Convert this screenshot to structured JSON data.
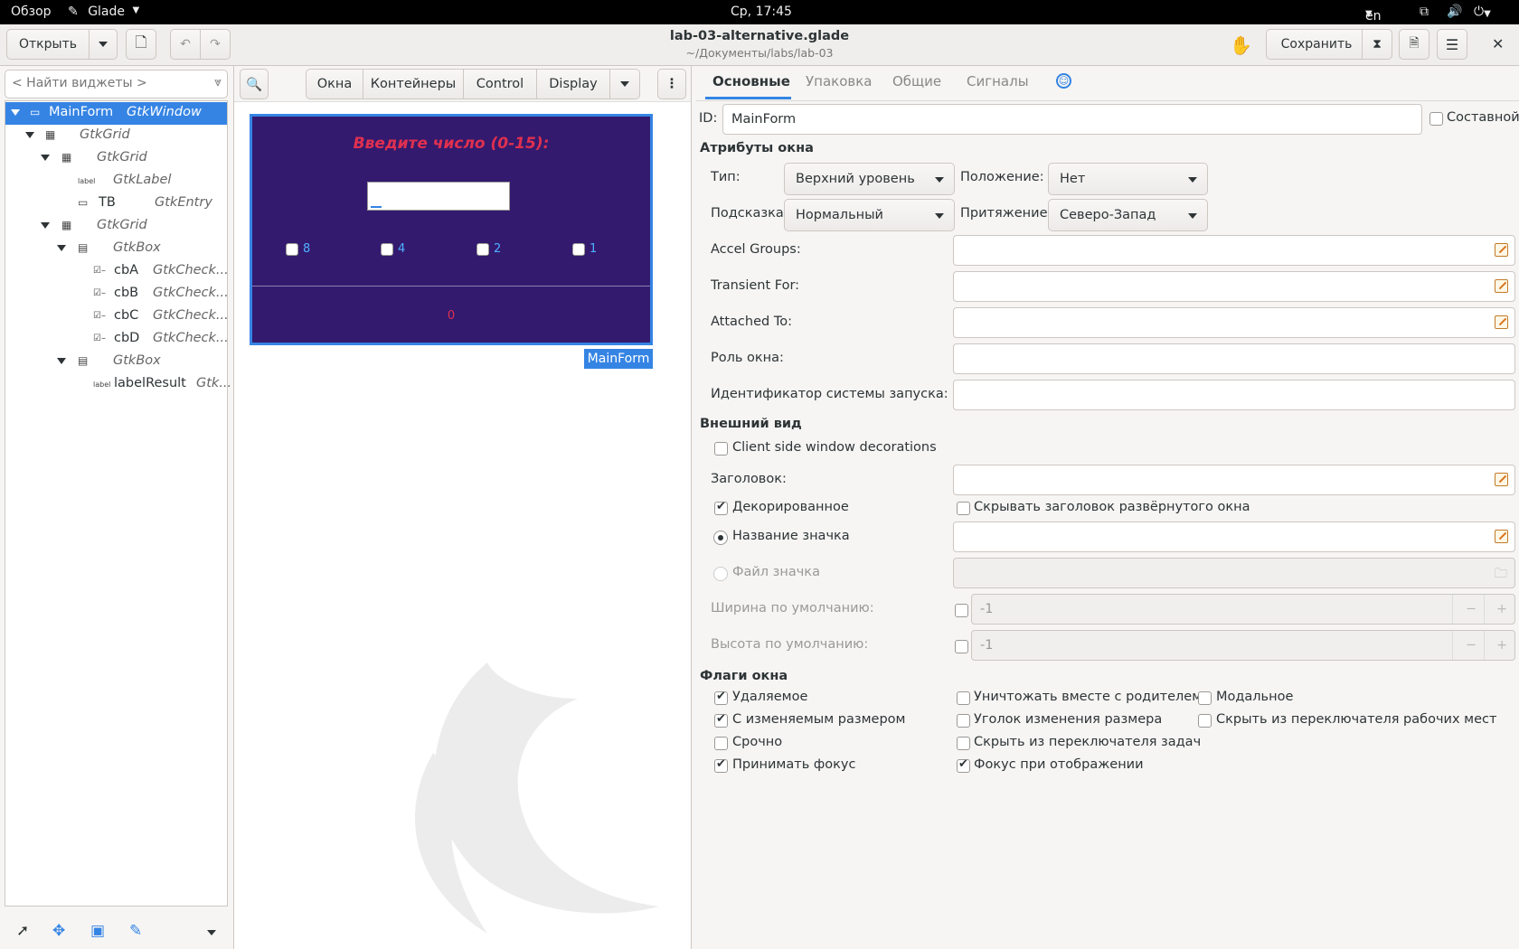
{
  "topbar": {
    "overview": "Обзор",
    "app": "Glade",
    "clock": "Ср, 17:45",
    "lang": "en"
  },
  "header": {
    "open_label": "Открыть",
    "title": "lab-03-alternative.glade",
    "subtitle": "~/Документы/labs/lab-03",
    "save_label": "Сохранить"
  },
  "left": {
    "search_placeholder": "< Найти виджеты >",
    "tree": [
      {
        "name": "MainForm",
        "type": "GtkWindow"
      },
      {
        "name": "",
        "type": "GtkGrid"
      },
      {
        "name": "",
        "type": "GtkGrid"
      },
      {
        "name": "",
        "type": "GtkLabel"
      },
      {
        "name": "TB",
        "type": "GtkEntry"
      },
      {
        "name": "",
        "type": "GtkGrid"
      },
      {
        "name": "",
        "type": "GtkBox"
      },
      {
        "name": "cbA",
        "type": "GtkCheck..."
      },
      {
        "name": "cbB",
        "type": "GtkCheck..."
      },
      {
        "name": "cbC",
        "type": "GtkCheck..."
      },
      {
        "name": "cbD",
        "type": "GtkCheck..."
      },
      {
        "name": "",
        "type": "GtkBox"
      },
      {
        "name": "labelResult",
        "type": "Gtk..."
      }
    ]
  },
  "palette": {
    "tabs": [
      "Окна",
      "Контейнеры",
      "Control",
      "Display"
    ]
  },
  "preview": {
    "prompt": "Введите число (0-15):",
    "checks": [
      "8",
      "4",
      "2",
      "1"
    ],
    "result": "0",
    "form_tag": "MainForm"
  },
  "editor": {
    "tabs": [
      "Основные",
      "Упаковка",
      "Общие",
      "Сигналы"
    ],
    "id_label": "ID:",
    "id_value": "MainForm",
    "composite": "Составной",
    "sec_window": "Атрибуты окна",
    "type_label": "Тип:",
    "type_value": "Верхний уровень",
    "pos_label": "Положение:",
    "pos_value": "Нет",
    "hint_label": "Подсказка:",
    "hint_value": "Нормальный",
    "gravity_label": "Притяжение:",
    "gravity_value": "Северо-Запад",
    "accel": "Accel Groups:",
    "transient": "Transient For:",
    "attached": "Attached To:",
    "role": "Роль окна:",
    "startup": "Идентификатор системы запуска:",
    "sec_look": "Внешний вид",
    "csd": "Client side window decorations",
    "title_label": "Заголовок:",
    "decorated": "Декорированное",
    "hide_title": "Скрывать заголовок развёрнутого окна",
    "icon_name": "Название значка",
    "icon_file": "Файл значка",
    "def_width": "Ширина по умолчанию:",
    "def_height": "Высота по умолчанию:",
    "width_value": "-1",
    "height_value": "-1",
    "sec_flags": "Флаги окна",
    "flags": {
      "deletable": "Удаляемое",
      "resizable": "С изменяемым размером",
      "urgent": "Срочно",
      "accept_focus": "Принимать фокус",
      "destroy_parent": "Уничтожать вместе с родителем",
      "grip": "Уголок изменения размера",
      "skip_taskbar": "Скрыть из переключателя задач",
      "focus_map": "Фокус при отображении",
      "modal": "Модальное",
      "skip_pager": "Скрыть из переключателя рабочих мест"
    }
  }
}
